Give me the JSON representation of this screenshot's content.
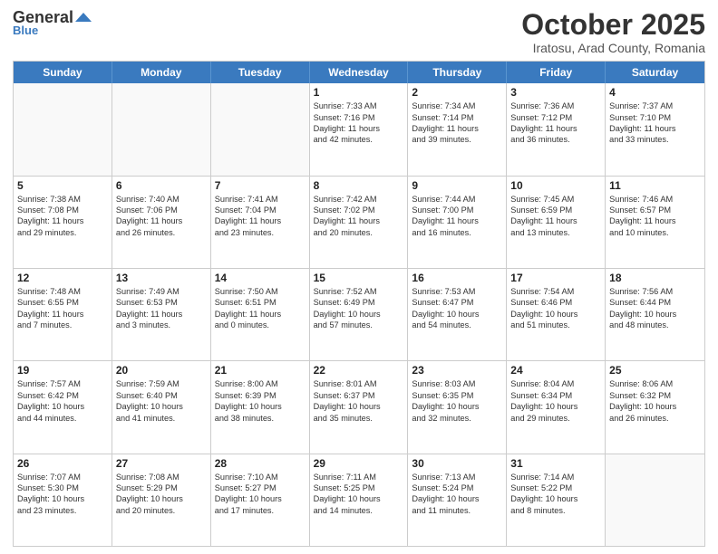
{
  "header": {
    "logo_general": "General",
    "logo_blue": "Blue",
    "month_title": "October 2025",
    "location": "Iratosu, Arad County, Romania"
  },
  "weekdays": [
    "Sunday",
    "Monday",
    "Tuesday",
    "Wednesday",
    "Thursday",
    "Friday",
    "Saturday"
  ],
  "rows": [
    [
      {
        "day": "",
        "text": ""
      },
      {
        "day": "",
        "text": ""
      },
      {
        "day": "",
        "text": ""
      },
      {
        "day": "1",
        "text": "Sunrise: 7:33 AM\nSunset: 7:16 PM\nDaylight: 11 hours\nand 42 minutes."
      },
      {
        "day": "2",
        "text": "Sunrise: 7:34 AM\nSunset: 7:14 PM\nDaylight: 11 hours\nand 39 minutes."
      },
      {
        "day": "3",
        "text": "Sunrise: 7:36 AM\nSunset: 7:12 PM\nDaylight: 11 hours\nand 36 minutes."
      },
      {
        "day": "4",
        "text": "Sunrise: 7:37 AM\nSunset: 7:10 PM\nDaylight: 11 hours\nand 33 minutes."
      }
    ],
    [
      {
        "day": "5",
        "text": "Sunrise: 7:38 AM\nSunset: 7:08 PM\nDaylight: 11 hours\nand 29 minutes."
      },
      {
        "day": "6",
        "text": "Sunrise: 7:40 AM\nSunset: 7:06 PM\nDaylight: 11 hours\nand 26 minutes."
      },
      {
        "day": "7",
        "text": "Sunrise: 7:41 AM\nSunset: 7:04 PM\nDaylight: 11 hours\nand 23 minutes."
      },
      {
        "day": "8",
        "text": "Sunrise: 7:42 AM\nSunset: 7:02 PM\nDaylight: 11 hours\nand 20 minutes."
      },
      {
        "day": "9",
        "text": "Sunrise: 7:44 AM\nSunset: 7:00 PM\nDaylight: 11 hours\nand 16 minutes."
      },
      {
        "day": "10",
        "text": "Sunrise: 7:45 AM\nSunset: 6:59 PM\nDaylight: 11 hours\nand 13 minutes."
      },
      {
        "day": "11",
        "text": "Sunrise: 7:46 AM\nSunset: 6:57 PM\nDaylight: 11 hours\nand 10 minutes."
      }
    ],
    [
      {
        "day": "12",
        "text": "Sunrise: 7:48 AM\nSunset: 6:55 PM\nDaylight: 11 hours\nand 7 minutes."
      },
      {
        "day": "13",
        "text": "Sunrise: 7:49 AM\nSunset: 6:53 PM\nDaylight: 11 hours\nand 3 minutes."
      },
      {
        "day": "14",
        "text": "Sunrise: 7:50 AM\nSunset: 6:51 PM\nDaylight: 11 hours\nand 0 minutes."
      },
      {
        "day": "15",
        "text": "Sunrise: 7:52 AM\nSunset: 6:49 PM\nDaylight: 10 hours\nand 57 minutes."
      },
      {
        "day": "16",
        "text": "Sunrise: 7:53 AM\nSunset: 6:47 PM\nDaylight: 10 hours\nand 54 minutes."
      },
      {
        "day": "17",
        "text": "Sunrise: 7:54 AM\nSunset: 6:46 PM\nDaylight: 10 hours\nand 51 minutes."
      },
      {
        "day": "18",
        "text": "Sunrise: 7:56 AM\nSunset: 6:44 PM\nDaylight: 10 hours\nand 48 minutes."
      }
    ],
    [
      {
        "day": "19",
        "text": "Sunrise: 7:57 AM\nSunset: 6:42 PM\nDaylight: 10 hours\nand 44 minutes."
      },
      {
        "day": "20",
        "text": "Sunrise: 7:59 AM\nSunset: 6:40 PM\nDaylight: 10 hours\nand 41 minutes."
      },
      {
        "day": "21",
        "text": "Sunrise: 8:00 AM\nSunset: 6:39 PM\nDaylight: 10 hours\nand 38 minutes."
      },
      {
        "day": "22",
        "text": "Sunrise: 8:01 AM\nSunset: 6:37 PM\nDaylight: 10 hours\nand 35 minutes."
      },
      {
        "day": "23",
        "text": "Sunrise: 8:03 AM\nSunset: 6:35 PM\nDaylight: 10 hours\nand 32 minutes."
      },
      {
        "day": "24",
        "text": "Sunrise: 8:04 AM\nSunset: 6:34 PM\nDaylight: 10 hours\nand 29 minutes."
      },
      {
        "day": "25",
        "text": "Sunrise: 8:06 AM\nSunset: 6:32 PM\nDaylight: 10 hours\nand 26 minutes."
      }
    ],
    [
      {
        "day": "26",
        "text": "Sunrise: 7:07 AM\nSunset: 5:30 PM\nDaylight: 10 hours\nand 23 minutes."
      },
      {
        "day": "27",
        "text": "Sunrise: 7:08 AM\nSunset: 5:29 PM\nDaylight: 10 hours\nand 20 minutes."
      },
      {
        "day": "28",
        "text": "Sunrise: 7:10 AM\nSunset: 5:27 PM\nDaylight: 10 hours\nand 17 minutes."
      },
      {
        "day": "29",
        "text": "Sunrise: 7:11 AM\nSunset: 5:25 PM\nDaylight: 10 hours\nand 14 minutes."
      },
      {
        "day": "30",
        "text": "Sunrise: 7:13 AM\nSunset: 5:24 PM\nDaylight: 10 hours\nand 11 minutes."
      },
      {
        "day": "31",
        "text": "Sunrise: 7:14 AM\nSunset: 5:22 PM\nDaylight: 10 hours\nand 8 minutes."
      },
      {
        "day": "",
        "text": ""
      }
    ]
  ]
}
